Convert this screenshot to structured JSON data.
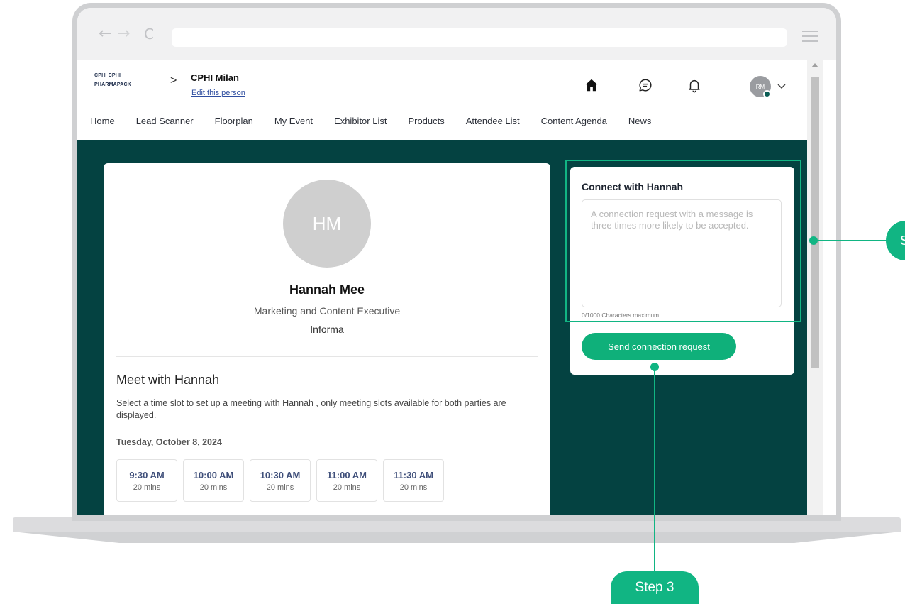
{
  "browser": {
    "back_glyph": "←",
    "forward_glyph": "→",
    "reload_glyph": "C"
  },
  "header": {
    "logo_line_1": "CPHI  CPHI",
    "logo_line_2": "PHARMAPACK",
    "breadcrumb_separator": ">",
    "event_name": "CPHI Milan",
    "edit_link": "Edit this person",
    "avatar_initials": "RM",
    "icons": [
      "home-icon",
      "chat-icon",
      "bell-icon",
      "chevron-down-icon"
    ]
  },
  "nav": {
    "items": [
      "Home",
      "Lead Scanner",
      "Floorplan",
      "My Event",
      "Exhibitor List",
      "Products",
      "Attendee List",
      "Content Agenda",
      "News"
    ]
  },
  "profile": {
    "initials": "HM",
    "name": "Hannah Mee",
    "title": "Marketing and Content Executive",
    "company": "Informa"
  },
  "meeting": {
    "heading": "Meet with Hannah",
    "description": "Select a time slot to set up a meeting with Hannah , only meeting slots available for both parties are displayed.",
    "date": "Tuesday, October 8, 2024",
    "slots": [
      {
        "time": "9:30 AM",
        "duration": "20 mins"
      },
      {
        "time": "10:00 AM",
        "duration": "20 mins"
      },
      {
        "time": "10:30 AM",
        "duration": "20 mins"
      },
      {
        "time": "11:00 AM",
        "duration": "20 mins"
      },
      {
        "time": "11:30 AM",
        "duration": "20 mins"
      }
    ]
  },
  "connect": {
    "heading": "Connect with Hannah",
    "placeholder": "A connection request with a message is three times more likely to be accepted.",
    "value": "",
    "char_count": "0/1000 Characters maximum",
    "send_label": "Send connection request"
  },
  "annotations": {
    "step_right": "S",
    "step_bottom": "Step 3"
  },
  "colors": {
    "accent": "#11b583",
    "content_bg": "#044241",
    "button": "#0fb07a"
  }
}
